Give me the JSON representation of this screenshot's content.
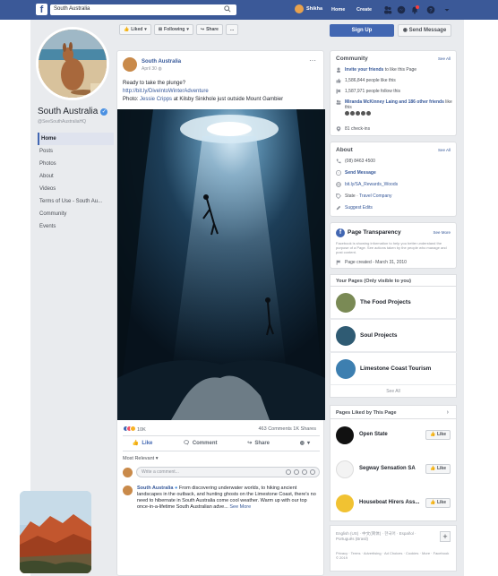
{
  "topbar": {
    "search_value": "South Australia",
    "user_name": "Shikha",
    "home": "Home",
    "create": "Create",
    "brand_color": "#3b5998"
  },
  "profile": {
    "name": "South Australia",
    "handle": "@SeeSouthAustraliaHQ"
  },
  "nav": [
    "Home",
    "Posts",
    "Photos",
    "About",
    "Videos",
    "Terms of Use - South Au...",
    "Community",
    "Events"
  ],
  "actions": {
    "liked": "Liked",
    "following": "Following",
    "share": "Share",
    "more": "...",
    "sign_up": "Sign Up",
    "send_message": "Send Message"
  },
  "post": {
    "page_name": "South Australia",
    "date": "April 30",
    "line1": "Ready to take the plunge?",
    "link": "http://bit.ly/DiveIntoWinterAdventure",
    "photo_prefix": "Photo: ",
    "photo_credit": "Jessie Cripps",
    "photo_suffix": " at Kilsby Sinkhole just outside Mount Gambier",
    "reactions_count": "10K",
    "comments_shares": "463 Comments  1K Shares",
    "like": "Like",
    "comment": "Comment",
    "share": "Share",
    "most_relevant": "Most Relevant",
    "comment_placeholder": "Write a comment...",
    "reply_name": "South Australia",
    "reply_text": "From discovering underwater worlds, to hiking ancient landscapes in the outback, and hunting ghosts on the Limestone Coast, there's no need to hibernate in South Australia come cool weather. Warm up with our top once-in-a-lifetime South Australian adve...",
    "see_more": "See More"
  },
  "community": {
    "title": "Community",
    "see_all": "See All",
    "invite_link": "Invite your friends",
    "invite_rest": " to like this Page",
    "likes": "1,586,844 people like this",
    "follows": "1,587,971 people follow this",
    "friends_link": "Miranda McKinney Laing and 186 other friends",
    "friends_rest": " like this",
    "checkins": "81 check-ins"
  },
  "about": {
    "title": "About",
    "see_all": "See All",
    "phone": "(08) 8463 4500",
    "send_message": "Send Message",
    "url": "bit.ly/SA_Rewards_Woods",
    "category_prefix": "State · ",
    "category": "Travel Company",
    "suggest": "Suggest Edits"
  },
  "transparency": {
    "title": "Page Transparency",
    "see_more": "See More",
    "desc": "Facebook is showing information to help you better understand the purpose of a Page. See actions taken by the people who manage and post content.",
    "created": "Page created - March 31, 2010"
  },
  "your_pages": {
    "header": "Your Pages (Only visible to you)",
    "items": [
      "The Food Projects",
      "Soul Projects",
      "Limestone Coast Tourism"
    ],
    "see_all": "See All"
  },
  "liked_pages": {
    "header": "Pages Liked by This Page",
    "items": [
      "Open State",
      "Segway Sensation SA",
      "Houseboat Hirers Ass..."
    ],
    "like": "Like"
  },
  "footer": {
    "languages": "English (US) · 中文(简体) · 한국어 · Español · Português (Brasil)",
    "links": "Privacy · Terms · Advertising · Ad Choices · Cookies · More · Facebook © 2019"
  }
}
